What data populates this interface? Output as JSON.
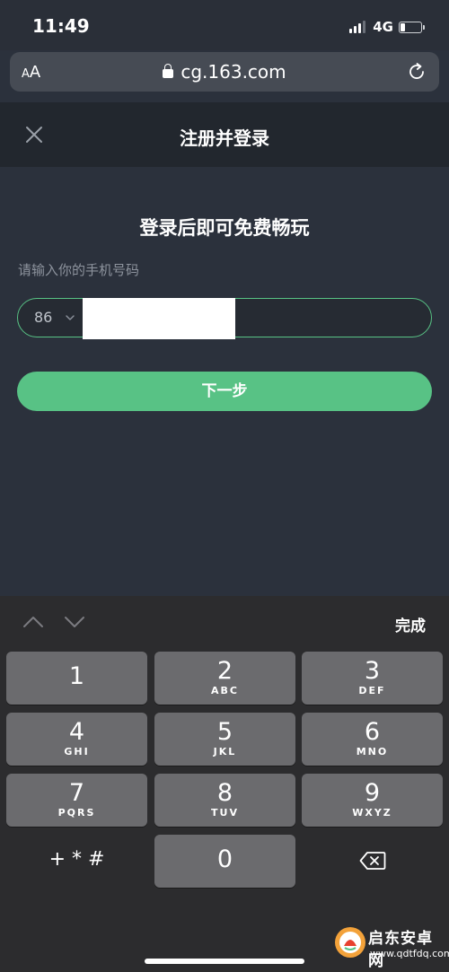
{
  "status_bar": {
    "time": "11:49",
    "network": "4G",
    "battery_level": 0.25
  },
  "browser": {
    "text_size_label_small": "A",
    "text_size_label_large": "A",
    "url": "cg.163.com"
  },
  "header": {
    "title": "注册并登录"
  },
  "content": {
    "title": "登录后即可免费畅玩",
    "phone_label": "请输入你的手机号码",
    "country_code": "86",
    "next_button": "下一步"
  },
  "keyboard": {
    "done_label": "完成",
    "keys": [
      {
        "num": "1",
        "letters": ""
      },
      {
        "num": "2",
        "letters": "ABC"
      },
      {
        "num": "3",
        "letters": "DEF"
      },
      {
        "num": "4",
        "letters": "GHI"
      },
      {
        "num": "5",
        "letters": "JKL"
      },
      {
        "num": "6",
        "letters": "MNO"
      },
      {
        "num": "7",
        "letters": "PQRS"
      },
      {
        "num": "8",
        "letters": "TUV"
      },
      {
        "num": "9",
        "letters": "WXYZ"
      },
      {
        "num": "0",
        "letters": ""
      }
    ],
    "symbols_label": "+ * #"
  },
  "watermark": {
    "name": "启东安卓网",
    "url": "www.qdtfdq.com"
  },
  "colors": {
    "accent": "#58c285",
    "background": "#2b313c",
    "header": "#22272e",
    "keyboard": "#2c2c2e",
    "key": "#6b6b6e"
  }
}
